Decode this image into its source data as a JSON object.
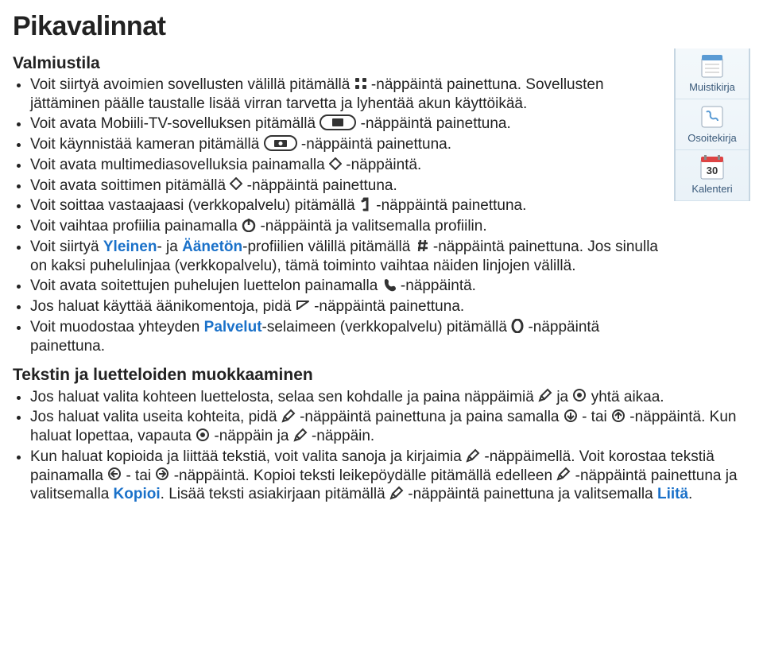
{
  "title": "Pikavalinnat",
  "section1": {
    "heading": "Valmiustila",
    "items": [
      {
        "t1": "Voit siirtyä avoimien sovellusten välillä pitämällä ",
        "t2": "-näppäintä painettuna. Sovellusten jättäminen päälle taustalle lisää virran tarvetta ja lyhentää akun käyttöikää."
      },
      {
        "t1": "Voit avata Mobiili-TV-sovelluksen pitämällä ",
        "t2": "-näppäintä painettuna."
      },
      {
        "t1": "Voit käynnistää kameran pitämällä ",
        "t2": "-näppäintä painettuna."
      },
      {
        "t1": "Voit avata multimediasovelluksia painamalla ",
        "t2": "-näppäintä."
      },
      {
        "t1": "Voit avata soittimen pitämällä ",
        "t2": "-näppäintä painettuna."
      },
      {
        "t1": "Voit soittaa vastaajaasi (verkkopalvelu) pitämällä ",
        "t2": "-näppäintä painettuna."
      },
      {
        "t1": "Voit vaihtaa profiilia painamalla ",
        "t2": "-näppäintä ja valitsemalla profiilin."
      },
      {
        "t1a": "Voit siirtyä ",
        "link1": "Yleinen",
        "t1b": "- ja ",
        "link2": "Äänetön",
        "t1c": "-profiilien välillä pitämällä ",
        "t2": "-näppäintä painettuna. Jos sinulla on kaksi puhelulinjaa (verkkopalvelu), tämä toiminto vaihtaa näiden linjojen välillä."
      },
      {
        "t1": "Voit avata soitettujen puhelujen luettelon painamalla ",
        "t2": "-näppäintä."
      },
      {
        "t1": "Jos haluat käyttää äänikomentoja, pidä ",
        "t2": "-näppäintä painettuna."
      },
      {
        "t1a": "Voit muodostaa yhteyden ",
        "link1": "Palvelut",
        "t1b": "-selaimeen (verkkopalvelu) pitämällä ",
        "t2": "-näppäintä painettuna."
      }
    ]
  },
  "sidebar": [
    {
      "label": "Muistikirja"
    },
    {
      "label": "Osoitekirja"
    },
    {
      "label": "Kalenteri",
      "badge": "30"
    }
  ],
  "section2": {
    "heading": "Tekstin ja luetteloiden muokkaaminen",
    "items": [
      {
        "t1": "Jos haluat valita kohteen luettelosta, selaa sen kohdalle ja paina näppäimiä ",
        "mid": " ja ",
        "t2": " yhtä aikaa."
      },
      {
        "t1": "Jos haluat valita useita kohteita, pidä ",
        "t2": "-näppäintä painettuna ja paina samalla ",
        "t3": "- tai ",
        "t4": "-näppäintä. Kun haluat lopettaa, vapauta ",
        "t5": "-näppäin ja ",
        "t6": "-näppäin."
      },
      {
        "t1": "Kun haluat kopioida ja liittää tekstiä, voit valita sanoja ja kirjaimia ",
        "t2": "-näppäimellä. Voit korostaa tekstiä painamalla ",
        "t3": "- tai ",
        "t4": "-näppäintä. Kopioi teksti leikepöydälle pitämällä edelleen ",
        "t5": "-näppäintä painettuna ja valitsemalla ",
        "link1": "Kopioi",
        "t6": ". Lisää teksti asiakirjaan pitämällä ",
        "t7": "-näppäintä painettuna ja valitsemalla ",
        "link2": "Liitä",
        "t8": "."
      }
    ]
  }
}
